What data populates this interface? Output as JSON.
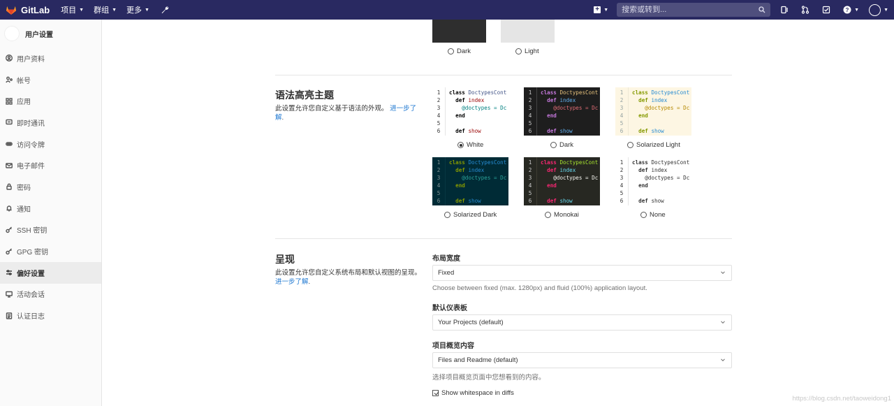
{
  "topnav": {
    "brand": "GitLab",
    "menu": [
      {
        "label": "项目"
      },
      {
        "label": "群组"
      },
      {
        "label": "更多"
      }
    ],
    "search_placeholder": "搜索或转到...",
    "colors": {
      "bar": "#292961"
    }
  },
  "sidebar": {
    "title": "用户设置",
    "items": [
      {
        "label": "用户资料",
        "icon": "user-icon"
      },
      {
        "label": "帐号",
        "icon": "account-icon"
      },
      {
        "label": "应用",
        "icon": "applications-icon"
      },
      {
        "label": "即时通讯",
        "icon": "chat-icon"
      },
      {
        "label": "访问令牌",
        "icon": "token-icon"
      },
      {
        "label": "电子邮件",
        "icon": "mail-icon"
      },
      {
        "label": "密码",
        "icon": "lock-icon"
      },
      {
        "label": "通知",
        "icon": "bell-icon"
      },
      {
        "label": "SSH 密钥",
        "icon": "key-icon"
      },
      {
        "label": "GPG 密钥",
        "icon": "key-icon"
      },
      {
        "label": "偏好设置",
        "icon": "preferences-icon",
        "active": true
      },
      {
        "label": "活动会话",
        "icon": "monitor-icon"
      },
      {
        "label": "认证日志",
        "icon": "log-icon"
      }
    ]
  },
  "theme": {
    "options": [
      {
        "label": "Dark",
        "color": "#2e2e2e",
        "selected": false
      },
      {
        "label": "Light",
        "color": "#e5e5e5",
        "selected": false
      }
    ]
  },
  "syntax": {
    "title": "语法高亮主题",
    "description": "此设置允许您自定义基于语法的外观。",
    "learn_more": "进一步了解",
    "code_lines": [
      "class DoctypesCont",
      "  def index",
      "    @doctypes = Dc",
      "  end",
      "",
      "  def show"
    ],
    "line_numbers": [
      "1",
      "2",
      "3",
      "4",
      "5",
      "6"
    ],
    "options": [
      {
        "label": "White",
        "selected": true
      },
      {
        "label": "Dark",
        "selected": false
      },
      {
        "label": "Solarized Light",
        "selected": false
      },
      {
        "label": "Solarized Dark",
        "selected": false
      },
      {
        "label": "Monokai",
        "selected": false
      },
      {
        "label": "None",
        "selected": false
      }
    ]
  },
  "display": {
    "title": "呈现",
    "description": "此设置允许您自定义系统布局和默认视图的呈现。",
    "learn_more": "进一步了解",
    "layout_width": {
      "label": "布局宽度",
      "value": "Fixed",
      "help": "Choose between fixed (max. 1280px) and fluid (100%) application layout."
    },
    "dashboard": {
      "label": "默认仪表板",
      "value": "Your Projects (default)"
    },
    "project_overview": {
      "label": "项目概览内容",
      "value": "Files and Readme (default)",
      "help": "选择项目概览页面中您想看到的内容。"
    },
    "whitespace": {
      "label": "Show whitespace in diffs",
      "checked": true
    }
  },
  "watermark": "https://blog.csdn.net/taoweidong1"
}
